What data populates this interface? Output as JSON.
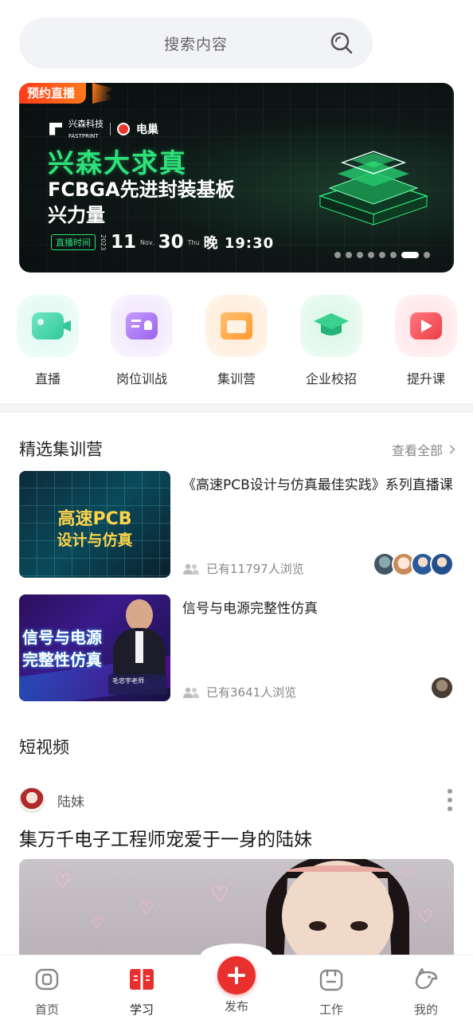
{
  "search": {
    "placeholder": "搜索内容"
  },
  "banner": {
    "tag": "预约直播",
    "brand": "兴森科技",
    "brand_en": "FASTPRINT",
    "partner": "电巢",
    "title_line1": "兴森大求真",
    "title_line2": "FCBGA先进封装基板",
    "title_line3": "兴力量",
    "time_label": "直播时间",
    "year": "2023",
    "month": "11",
    "month_unit": "Nov.",
    "day": "30",
    "weekday": "Thu",
    "time": "晚 19:30",
    "slide_count": 8,
    "active_slide": 7
  },
  "categories": [
    {
      "label": "直播",
      "icon": "live-camera-icon",
      "color": "#3fd3a7"
    },
    {
      "label": "岗位训战",
      "icon": "badge-card-icon",
      "color": "#a774f0"
    },
    {
      "label": "集训营",
      "icon": "folder-icon",
      "color": "#ffa33c"
    },
    {
      "label": "企业校招",
      "icon": "graduation-cap-icon",
      "color": "#2fc88a"
    },
    {
      "label": "提升课",
      "icon": "video-play-icon",
      "color": "#f2545b"
    }
  ],
  "camps": {
    "title": "精选集训营",
    "see_all": "查看全部",
    "items": [
      {
        "thumb_line1": "高速PCB",
        "thumb_line2": "设计与仿真",
        "title": "《高速PCB设计与仿真最佳实践》系列直播课",
        "views": "已有11797人浏览",
        "avatar_count": 4
      },
      {
        "thumb_line1": "信号与电源",
        "thumb_line2": "完整性仿真",
        "thumb_caption": "毛忠宇老师",
        "title": "信号与电源完整性仿真",
        "views": "已有3641人浏览",
        "avatar_count": 1
      }
    ]
  },
  "shorts": {
    "title": "短视频",
    "author": "陆妹",
    "video_title": "集万千电子工程师宠爱于一身的陆妹"
  },
  "nav": {
    "items": [
      {
        "label": "首页",
        "icon": "home-chip-icon"
      },
      {
        "label": "学习",
        "icon": "book-icon",
        "active": true
      },
      {
        "label": "发布",
        "icon": "plus-icon"
      },
      {
        "label": "工作",
        "icon": "briefcase-icon"
      },
      {
        "label": "我的",
        "icon": "bird-icon"
      }
    ]
  },
  "colors": {
    "accent": "#e8312f",
    "live_green": "#2ee27a"
  }
}
